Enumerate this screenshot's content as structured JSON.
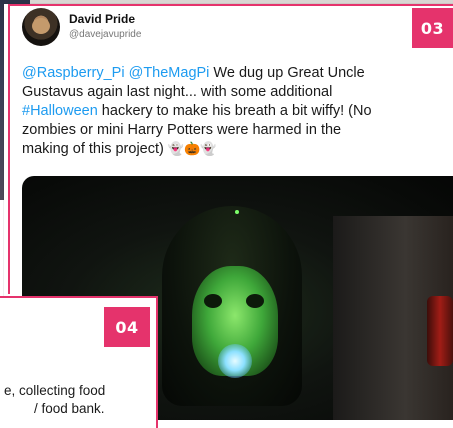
{
  "tweet": {
    "badge": "03",
    "author_name": "David Pride",
    "author_handle": "@davejavupride",
    "lines": [
      [
        {
          "t": "mention",
          "v": "@Raspberry_Pi"
        },
        {
          "t": "text",
          "v": " "
        },
        {
          "t": "mention",
          "v": "@TheMagPi"
        },
        {
          "t": "text",
          "v": " We dug up Great Uncle"
        }
      ],
      [
        {
          "t": "text",
          "v": "Gustavus again last night... with some additional"
        }
      ],
      [
        {
          "t": "hashtag",
          "v": "#Halloween"
        },
        {
          "t": "text",
          "v": " hackery to make his breath a bit wiffy! (No"
        }
      ],
      [
        {
          "t": "text",
          "v": "zombies or mini Harry Potters were harmed in the"
        }
      ],
      [
        {
          "t": "text",
          "v": "making of this project) "
        },
        {
          "t": "emoji",
          "v": "👻🎃👻"
        }
      ]
    ],
    "media_icon": "halloween-skull-photo"
  },
  "card04": {
    "badge": "04",
    "line1": "e, collecting food",
    "line2": "/ food bank."
  },
  "colors": {
    "accent": "#e5336c",
    "link": "#1d9bf0"
  }
}
